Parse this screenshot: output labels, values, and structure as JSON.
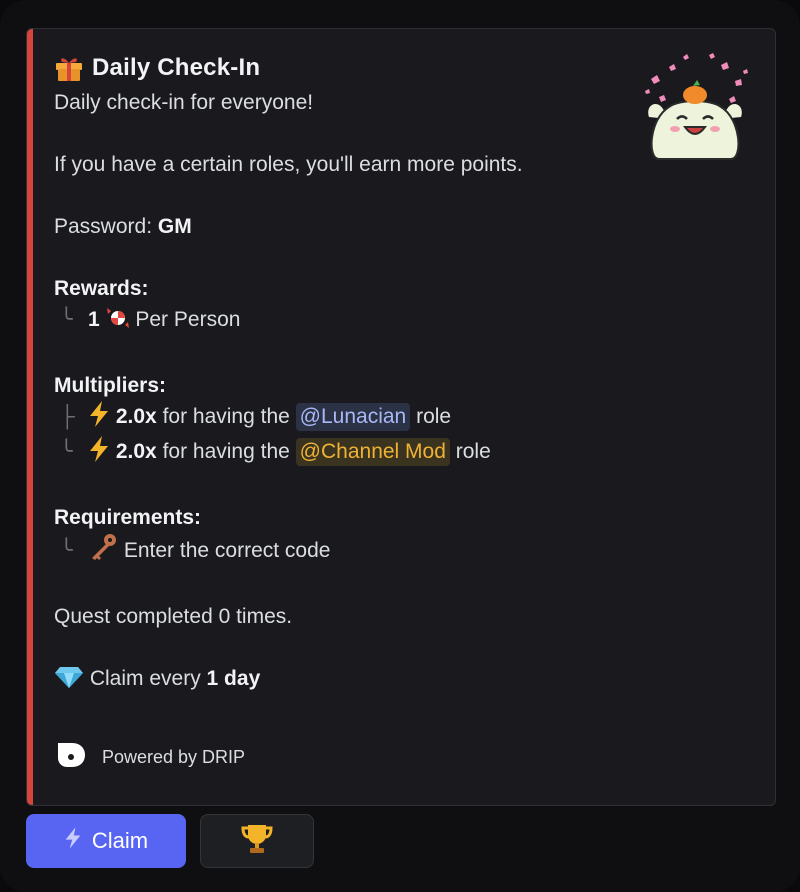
{
  "embed": {
    "accent_color": "#d6453b",
    "title": "Daily Check-In",
    "title_icon": "gift-icon",
    "description": "Daily check-in for everyone!",
    "roles_note": "If you have a certain roles, you'll earn more points.",
    "password_label": "Password:",
    "password_value": "GM",
    "rewards": {
      "heading": "Rewards:",
      "amount": "1",
      "item_icon": "candy-icon",
      "per": "Per Person"
    },
    "multipliers": {
      "heading": "Multipliers:",
      "items": [
        {
          "icon": "lightning-icon",
          "value": "2.0x",
          "prefix": "for having the",
          "role": "@Lunacian",
          "suffix": "role",
          "role_color": "#a8b8f6"
        },
        {
          "icon": "lightning-icon",
          "value": "2.0x",
          "prefix": "for having the",
          "role": "@Channel Mod",
          "suffix": "role",
          "role_color": "#f0b232"
        }
      ]
    },
    "requirements": {
      "heading": "Requirements:",
      "items": [
        {
          "icon": "key-icon",
          "text": "Enter the correct code"
        }
      ]
    },
    "completed_text": "Quest completed 0 times.",
    "claim_frequency": {
      "icon": "diamond-icon",
      "prefix": "Claim every",
      "value": "1 day"
    },
    "footer": {
      "icon": "drip-logo-icon",
      "text": "Powered by DRIP"
    },
    "thumbnail": "mascot-thumbnail"
  },
  "buttons": {
    "claim_label": "Claim",
    "claim_icon": "lightning-icon",
    "claim_color": "#5865f2",
    "leaderboard_icon": "trophy-icon"
  }
}
